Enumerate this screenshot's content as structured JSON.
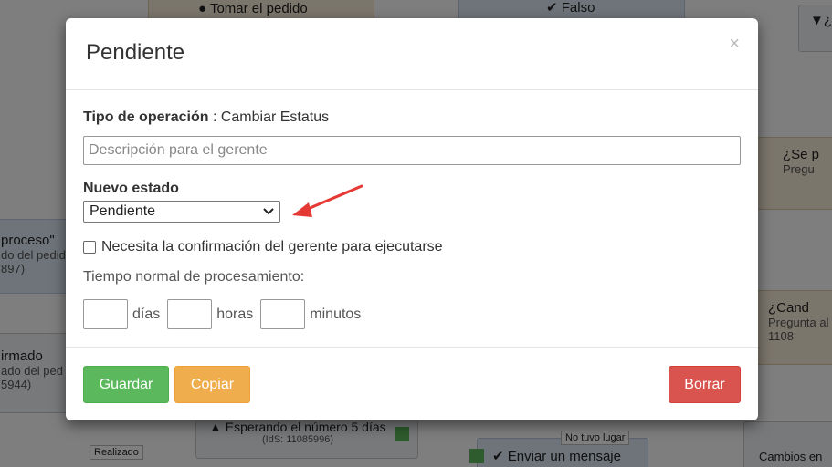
{
  "background": {
    "nodes": [
      {
        "label": "Tomar el pedido"
      },
      {
        "label": "Falso"
      },
      {
        "label": "¿"
      },
      {
        "label": "¿Se p",
        "sub": "Pregu"
      },
      {
        "label": "proceso\"",
        "sub": "do del pedid",
        "sub2": "897)"
      },
      {
        "label": "¿Cand",
        "sub": "Pregunta al",
        "sub2": "1108"
      },
      {
        "label": "irmado",
        "sub": "ado del ped",
        "sub2": "5944)"
      },
      {
        "label": "Esperando el número 5 días",
        "sub": "(IdS: 11085996)"
      },
      {
        "label": "Enviar un mensaje"
      },
      {
        "label": "Cambios en"
      }
    ],
    "chips": [
      "Realizado",
      "No tuvo lugar"
    ]
  },
  "modal": {
    "title": "Pendiente",
    "close": "×",
    "operation_label": "Tipo de operación",
    "operation_sep": " : ",
    "operation_value": "Cambiar Estatus",
    "description_placeholder": "Descripción para el gerente",
    "description_value": "",
    "new_state_label": "Nuevo estado",
    "new_state_selected": "Pendiente",
    "confirm_label": "Necesita la confirmación del gerente para ejecutarse",
    "confirm_checked": false,
    "time_label": "Tiempo normal de procesamiento:",
    "time_units": {
      "days": "días",
      "hours": "horas",
      "minutes": "minutos"
    },
    "buttons": {
      "save": "Guardar",
      "copy": "Copiar",
      "delete": "Borrar"
    }
  }
}
